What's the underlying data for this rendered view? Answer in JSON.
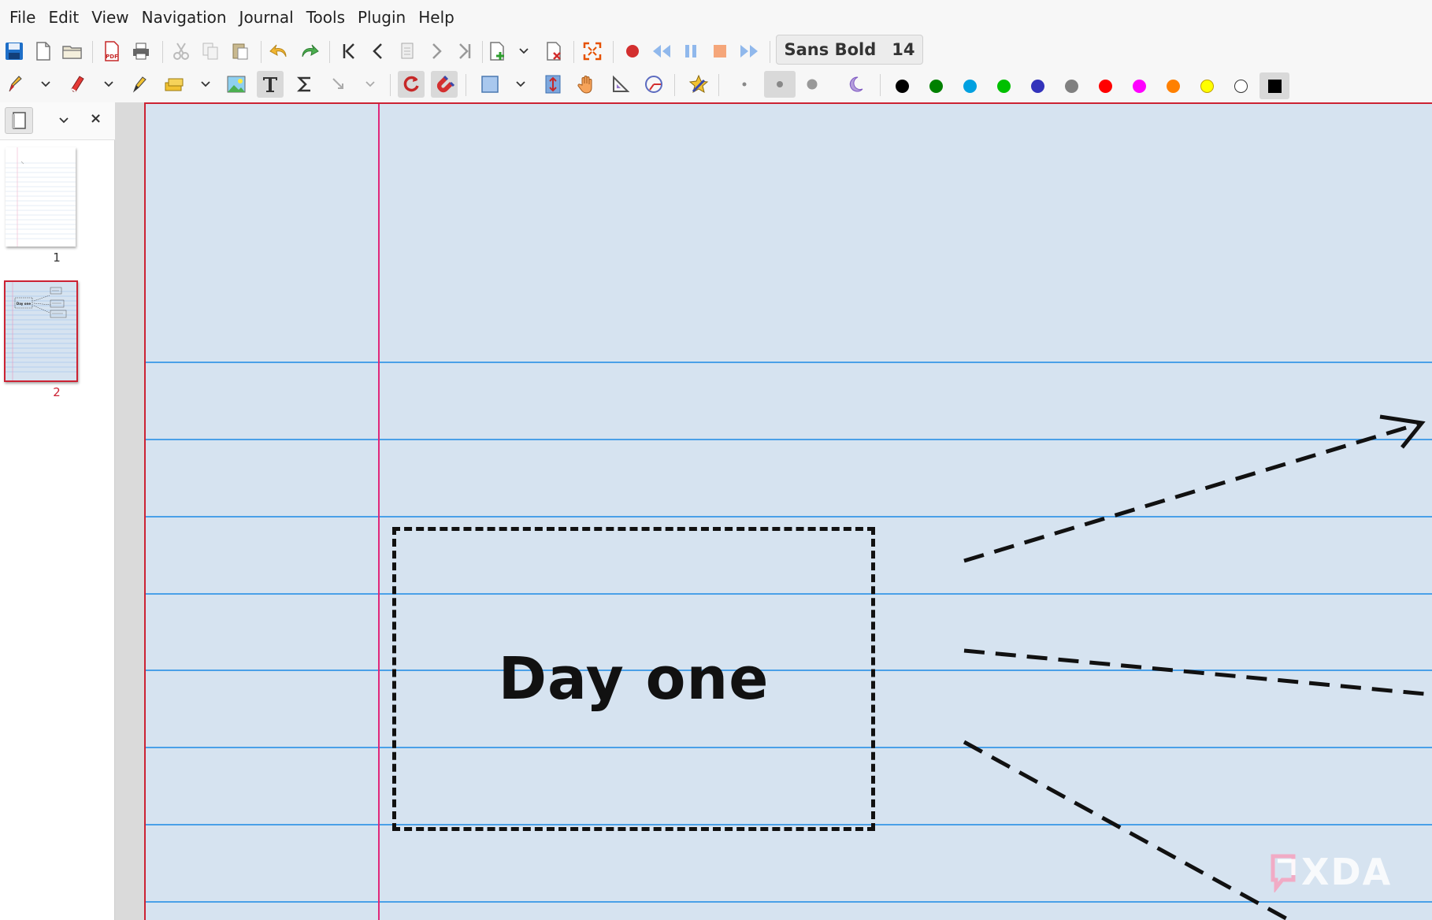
{
  "menu": [
    "File",
    "Edit",
    "View",
    "Navigation",
    "Journal",
    "Tools",
    "Plugin",
    "Help"
  ],
  "toolbar": {
    "font_name": "Sans Bold",
    "font_size": "14",
    "palette_colors": [
      "#000000",
      "#008000",
      "#00a0e0",
      "#00c000",
      "#3333bb",
      "#808080",
      "#ff0000",
      "#ff00ff",
      "#ff8000",
      "#ffff00",
      "#ffffff"
    ],
    "selected_color": "#000000"
  },
  "sidebar": {
    "pages": [
      {
        "label": "1",
        "selected": false
      },
      {
        "label": "2",
        "selected": true
      }
    ],
    "thumb_text": "Day one"
  },
  "canvas": {
    "box_text": "Day one",
    "paper_color": "#d6e3f0",
    "rule_color": "#4aa0e8",
    "margin_color": "#e0287a"
  },
  "watermark": "XDA"
}
